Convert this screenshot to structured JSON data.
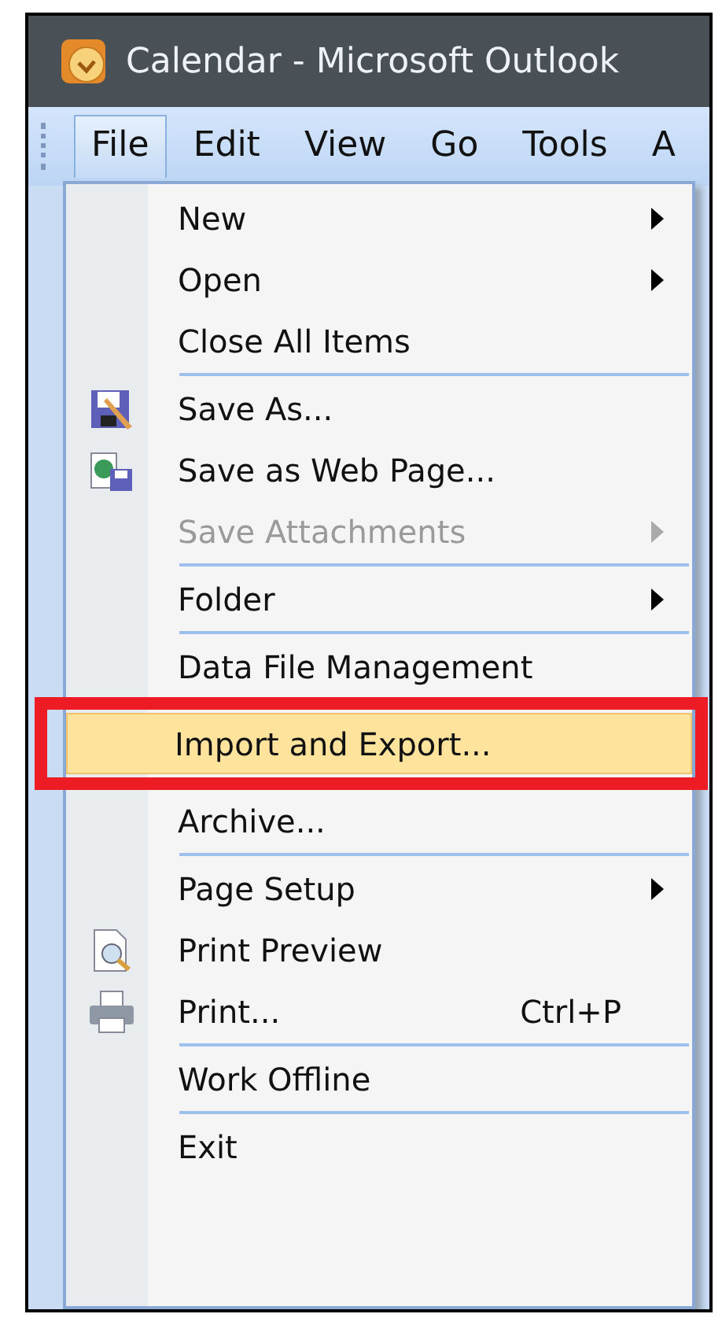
{
  "window": {
    "title": "Calendar - Microsoft Outlook"
  },
  "menubar": [
    {
      "label": "File",
      "selected": true
    },
    {
      "label": "Edit",
      "selected": false
    },
    {
      "label": "View",
      "selected": false
    },
    {
      "label": "Go",
      "selected": false
    },
    {
      "label": "Tools",
      "selected": false
    },
    {
      "label": "A",
      "selected": false
    }
  ],
  "file_menu": [
    {
      "kind": "item",
      "label": "New",
      "submenu": true,
      "disabled": false,
      "selected": false,
      "highlighted": false
    },
    {
      "kind": "item",
      "label": "Open",
      "submenu": true,
      "disabled": false,
      "selected": false,
      "highlighted": false
    },
    {
      "kind": "item",
      "label": "Close All Items",
      "submenu": false,
      "disabled": false,
      "selected": false,
      "highlighted": false
    },
    {
      "kind": "separator"
    },
    {
      "kind": "item",
      "label": "Save As...",
      "submenu": false,
      "disabled": false,
      "selected": false,
      "highlighted": false
    },
    {
      "kind": "item",
      "label": "Save as Web Page...",
      "submenu": false,
      "disabled": false,
      "selected": false,
      "highlighted": false
    },
    {
      "kind": "item",
      "label": "Save Attachments",
      "submenu": true,
      "disabled": true,
      "selected": false,
      "highlighted": false
    },
    {
      "kind": "separator"
    },
    {
      "kind": "item",
      "label": "Folder",
      "submenu": true,
      "disabled": false,
      "selected": false,
      "highlighted": false
    },
    {
      "kind": "separator"
    },
    {
      "kind": "item",
      "label": "Data File Management",
      "submenu": false,
      "disabled": false,
      "selected": false,
      "highlighted": false
    },
    {
      "kind": "item",
      "label": "Import and Export...",
      "submenu": false,
      "disabled": false,
      "selected": true,
      "highlighted": true
    },
    {
      "kind": "item",
      "label": "Archive...",
      "submenu": false,
      "disabled": false,
      "selected": false,
      "highlighted": false
    },
    {
      "kind": "separator"
    },
    {
      "kind": "item",
      "label": "Page Setup",
      "submenu": true,
      "disabled": false,
      "selected": false,
      "highlighted": false
    },
    {
      "kind": "item",
      "label": "Print Preview",
      "submenu": false,
      "disabled": false,
      "selected": false,
      "highlighted": false
    },
    {
      "kind": "item",
      "label": "Print...",
      "shortcut": "Ctrl+P",
      "submenu": false,
      "disabled": false,
      "selected": false,
      "highlighted": false
    },
    {
      "kind": "separator"
    },
    {
      "kind": "item",
      "label": "Work Offline",
      "submenu": false,
      "disabled": false,
      "selected": false,
      "highlighted": false
    },
    {
      "kind": "separator"
    },
    {
      "kind": "item",
      "label": "Exit",
      "submenu": false,
      "disabled": false,
      "selected": false,
      "highlighted": false
    }
  ]
}
